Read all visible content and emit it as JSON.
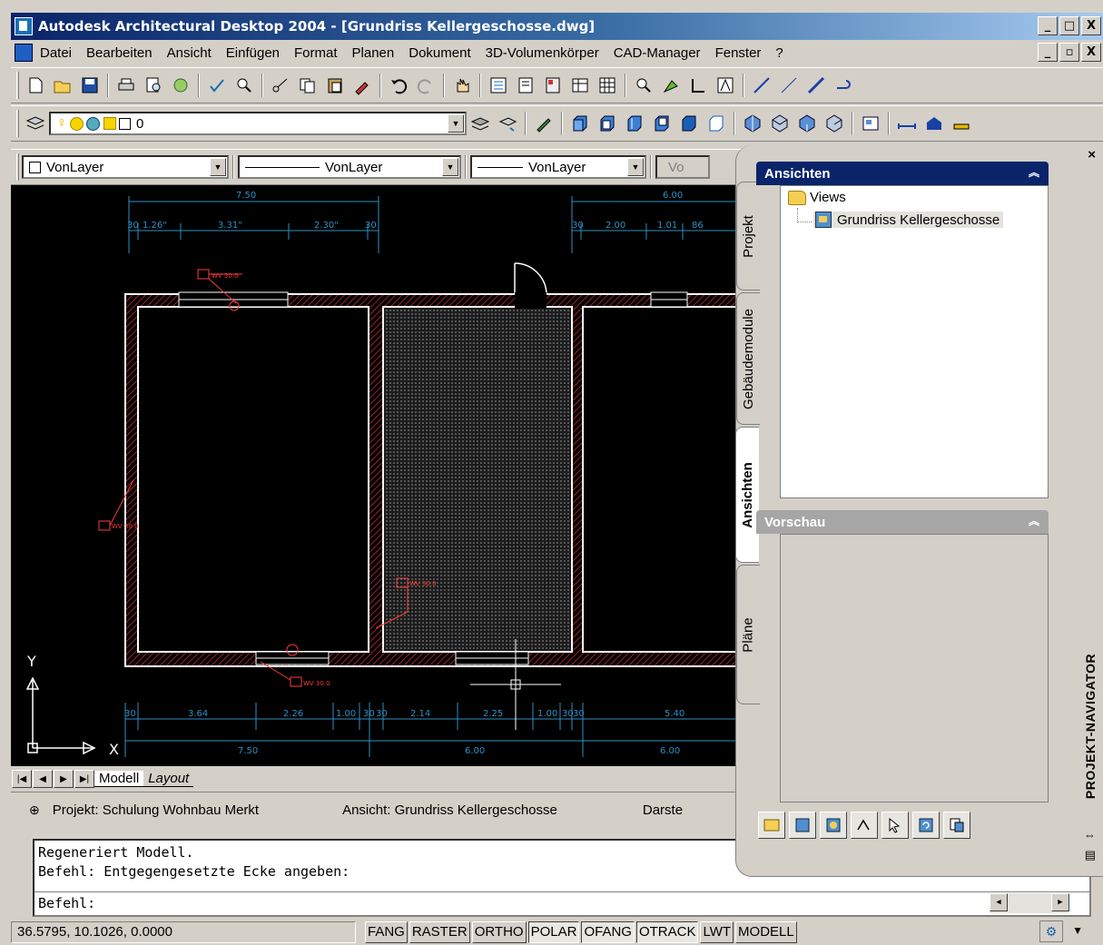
{
  "window": {
    "title": "Autodesk Architectural Desktop 2004 - [Grundriss Kellergeschosse.dwg]",
    "min": "_",
    "max": "□",
    "close": "X"
  },
  "menu": {
    "items": [
      "Datei",
      "Bearbeiten",
      "Ansicht",
      "Einfügen",
      "Format",
      "Planen",
      "Dokument",
      "3D-Volumenkörper",
      "CAD-Manager",
      "Fenster",
      "?"
    ],
    "doc_min": "_",
    "doc_restore": "▫",
    "doc_close": "X"
  },
  "layer": {
    "current": "0"
  },
  "props": {
    "color": "VonLayer",
    "linetype": "VonLayer",
    "lineweight": "VonLayer",
    "plotstyle": "Vo"
  },
  "drawing": {
    "dim_top": [
      "7.50",
      "6.00",
      "30",
      "1.26\"",
      "3.31\"",
      "2.30\"",
      "30",
      "30",
      "2.00",
      "1.01",
      "86"
    ],
    "dim_bottom": [
      "30",
      "3.64",
      "2.26",
      "1.00",
      "30",
      "30",
      "2.14",
      "2.25",
      "1.00",
      "30",
      "30",
      "5.40",
      "7.50",
      "6.00",
      "6.00"
    ],
    "tags": [
      "WV 30.0",
      "WV 30.0",
      "WV 30.0",
      "WV 30.0"
    ],
    "ucs_x": "X",
    "ucs_y": "Y"
  },
  "layout_tabs": {
    "model": "Modell",
    "layout": "Layout"
  },
  "project_bar": {
    "project": "Projekt: Schulung Wohnbau Merkt",
    "view": "Ansicht: Grundriss Kellergeschosse",
    "display": "Darste"
  },
  "command": {
    "line1": "Regeneriert Modell.",
    "line2": "Befehl: Entgegengesetzte Ecke angeben:",
    "prompt": "Befehl:"
  },
  "status": {
    "coords": "36.5795, 10.1026, 0.0000",
    "buttons": [
      {
        "label": "FANG",
        "on": false
      },
      {
        "label": "RASTER",
        "on": false
      },
      {
        "label": "ORTHO",
        "on": false
      },
      {
        "label": "POLAR",
        "on": true
      },
      {
        "label": "OFANG",
        "on": true
      },
      {
        "label": "OTRACK",
        "on": true
      },
      {
        "label": "LWT",
        "on": false
      },
      {
        "label": "MODELL",
        "on": false
      }
    ]
  },
  "navigator": {
    "tabs": [
      "Projekt",
      "Gebäudemodule",
      "Ansichten",
      "Pläne"
    ],
    "active_tab": "Ansichten",
    "section_views": "Ansichten",
    "section_preview": "Vorschau",
    "tree_root": "Views",
    "tree_child": "Grundriss Kellergeschosse",
    "palette_title": "PROJEKT-NAVIGATOR",
    "close": "×"
  },
  "colors": {
    "titlebar": "#0a246a",
    "section_active": "#0a246a",
    "section_inactive": "#a6a6a6",
    "wall_hatch": "#c83030",
    "dimension": "#2f8fc4",
    "tag": "#ff3b3b"
  }
}
